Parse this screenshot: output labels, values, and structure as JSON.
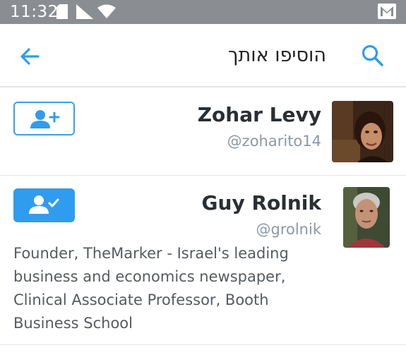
{
  "status_bar": {
    "time": "11:32",
    "icons": [
      "sim-card-icon",
      "signal-icon",
      "wifi-icon",
      "gmail-icon"
    ]
  },
  "app_bar": {
    "title": "הוסיפו אותך",
    "back_icon": "arrow-left-icon",
    "search_icon": "search-icon",
    "accent_color": "#2f9cef"
  },
  "users": [
    {
      "name": "Zohar Levy",
      "handle": "@zoharito14",
      "follow_state": "not-following",
      "bio": ""
    },
    {
      "name": "Guy Rolnik",
      "handle": "@grolnik",
      "follow_state": "following",
      "bio": "Founder, TheMarker - Israel's leading business and economics newspaper, Clinical Associate Professor, Booth Business School"
    }
  ]
}
